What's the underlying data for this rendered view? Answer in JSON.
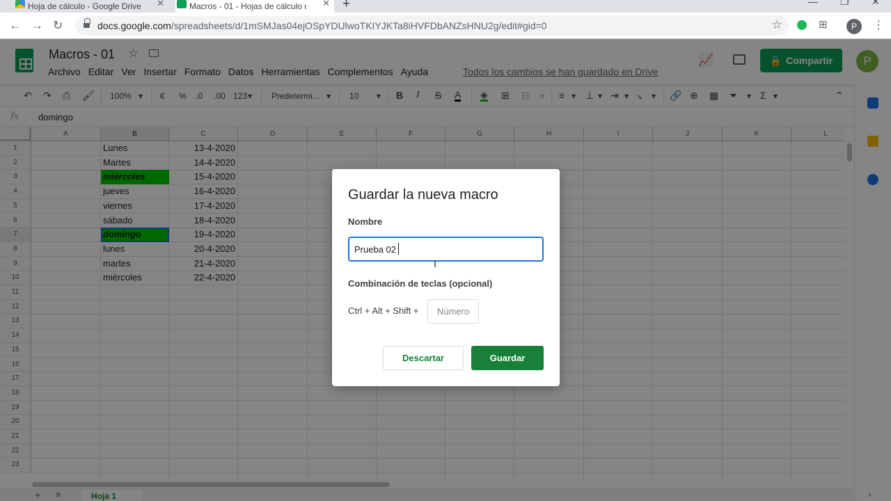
{
  "browser": {
    "tabs": [
      {
        "title": "Hoja de cálculo - Google Drive"
      },
      {
        "title": "Macros - 01 - Hojas de cálculo de Google"
      }
    ],
    "new_tab": "+",
    "url_host": "docs.google.com",
    "url_path": "/spreadsheets/d/1mSMJas04ejOSpYDUlwoTKIYJKTa8iHVFDbANZsHNU2g/edit#gid=0",
    "profile_initial": "P"
  },
  "doc": {
    "title": "Macros - 01",
    "menu": [
      "Archivo",
      "Editar",
      "Ver",
      "Insertar",
      "Formato",
      "Datos",
      "Herramientas",
      "Complementos",
      "Ayuda"
    ],
    "saved_status": "Todos los cambios se han guardado en Drive",
    "share_label": "Compartir",
    "avatar_initial": "P"
  },
  "toolbar": {
    "zoom": "100%",
    "currency": "€",
    "percent": "%",
    "dec_less": ".0",
    "dec_more": ".00",
    "format_more": "123",
    "font": "Predetermi...",
    "font_size": "10",
    "bold": "B",
    "italic": "I",
    "strike": "S",
    "text_color": "A",
    "sum": "Σ"
  },
  "formula_bar": {
    "fx": "fx",
    "value": "domingo"
  },
  "grid": {
    "columns": [
      "A",
      "B",
      "C",
      "D",
      "E",
      "F",
      "G",
      "H",
      "I",
      "J",
      "K",
      "L"
    ],
    "rows": [
      "1",
      "2",
      "3",
      "4",
      "5",
      "6",
      "7",
      "8",
      "9",
      "10",
      "11",
      "12",
      "13",
      "14",
      "15",
      "16",
      "17",
      "18",
      "19",
      "20",
      "21",
      "22",
      "23"
    ],
    "col_b": [
      "Lunes",
      "Martes",
      "miércoles",
      "jueves",
      "viernes",
      "sábado",
      "domingo",
      "lunes",
      "martes",
      "miércoles"
    ],
    "col_c": [
      "13-4-2020",
      "14-4-2020",
      "15-4-2020",
      "16-4-2020",
      "17-4-2020",
      "18-4-2020",
      "19-4-2020",
      "20-4-2020",
      "21-4-2020",
      "22-4-2020"
    ],
    "highlight_color": "#00c700"
  },
  "sheet_tab": "Hoja 1",
  "dialog": {
    "title": "Guardar la nueva macro",
    "name_label": "Nombre",
    "name_value": "Prueba 02",
    "shortcut_label": "Combinación de teclas (opcional)",
    "shortcut_prefix": "Ctrl + Alt + Shift +",
    "number_placeholder": "Número",
    "discard_label": "Descartar",
    "save_label": "Guardar",
    "accent_color": "#188038"
  }
}
